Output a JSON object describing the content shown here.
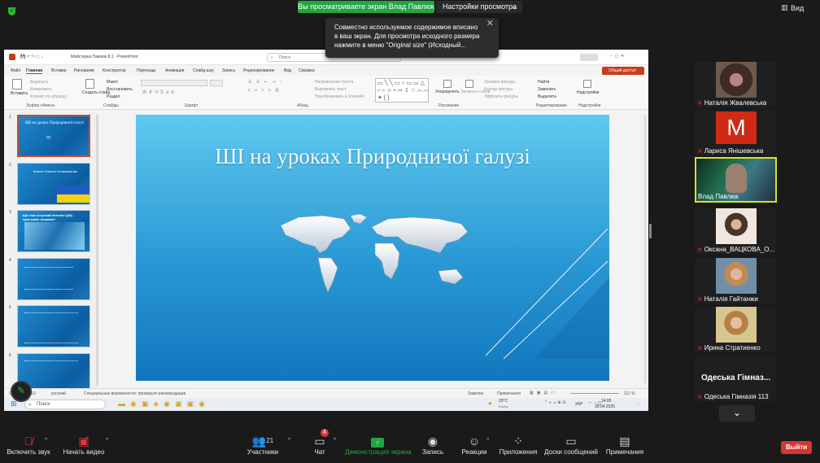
{
  "zoom": {
    "share_banner": "Вы просматриваете экран Влад Павлюк",
    "view_options": "Настройки просмотра",
    "view_mode": "Вид",
    "tooltip": "Совместно используемое содержимое вписано в ваш экран. Для просмотра исходного размера нажмите в меню \"Original size\" (Исходный..."
  },
  "ppt": {
    "doc_title": "Майстерка Павлюк 8.1 - PowerPoint",
    "search": "Поиск",
    "share_btn": "Общий доступ",
    "tabs": [
      "Файл",
      "Главная",
      "Вставка",
      "Рисование",
      "Конструктор",
      "Переходы",
      "Анимация",
      "Слайд-шоу",
      "Запись",
      "Рецензирование",
      "Вид",
      "Справка"
    ],
    "ribbon_groups": [
      "Буфер обмена",
      "Слайды",
      "Шрифт",
      "Абзац",
      "Рисование",
      "Редактирование",
      "Надстройки"
    ],
    "ribbon_items": {
      "paste": "Вставить",
      "cut": "Вырезать",
      "copy": "Копировать",
      "format_painter": "Формат по образцу",
      "new_slide": "Создать слайд",
      "layout": "Макет",
      "reset": "Восстановить",
      "section": "Раздел",
      "text_direction": "Направление текста",
      "align_text": "Выровнять текст",
      "smartart": "Преобразовать в SmartArt",
      "arrange": "Упорядочить",
      "quick_styles": "Экспресс-стили",
      "shape_fill": "Заливка фигуры",
      "shape_outline": "Контур фигуры",
      "shape_effects": "Эффекты фигуры",
      "find": "Найти",
      "replace": "Заменить",
      "select": "Выделить",
      "addins": "Надстройки"
    },
    "slide_numbers": [
      "1",
      "2",
      "3",
      "4",
      "5",
      "6"
    ],
    "thumb_titles": [
      "ШІ на уроках Природничої галузі",
      "Вчитель Фізичної та Інформатики",
      "Що таке штучний інтелект (ШІ) простими словами?",
      "",
      "",
      ""
    ],
    "slide_title": "ШІ на уроках Природничої галузі",
    "status": {
      "slide_of": "Слайд 1 из 13",
      "lang": "русский",
      "accessibility": "Специальные возможности: проверьте рекомендации",
      "notes": "Заметки",
      "comments": "Примечания",
      "zoom": "111 %"
    },
    "taskbar": {
      "search": "Поиск",
      "temp": "20°C",
      "weather": "Sunny",
      "lang": "УКР",
      "time": "14:05",
      "date": "30.04.2025"
    }
  },
  "participants": [
    {
      "name": "Наталія Жвалевська",
      "muted": true
    },
    {
      "name": "Лариса Янішевська",
      "muted": true,
      "initial": "M"
    },
    {
      "name": "Влад Павлюк",
      "muted": false,
      "active": true
    },
    {
      "name": "Оксана_ВАЦКОВА_О...",
      "muted": true
    },
    {
      "name": "Наталія Гайтанжи",
      "muted": true
    },
    {
      "name": "Ирина Стратиенко",
      "muted": true
    },
    {
      "name": "Одеська Гімназія 113",
      "muted": true,
      "display": "Одеська  Гімназ..."
    }
  ],
  "toolbar": {
    "unmute": "Включить звук",
    "start_video": "Начать видео",
    "participants": "Участники",
    "participants_count": "21",
    "chat": "Чат",
    "chat_badge": "4",
    "share_screen": "Демонстрация экрана",
    "record": "Запись",
    "reactions": "Реакции",
    "apps": "Приложения",
    "whiteboards": "Доски сообщений",
    "notes": "Примечания",
    "leave": "Выйти"
  },
  "colors": {
    "share_green": "#23a543",
    "leave_red": "#d43535",
    "active_border": "#d7e12e",
    "ppt_accent": "#c43e1c"
  }
}
